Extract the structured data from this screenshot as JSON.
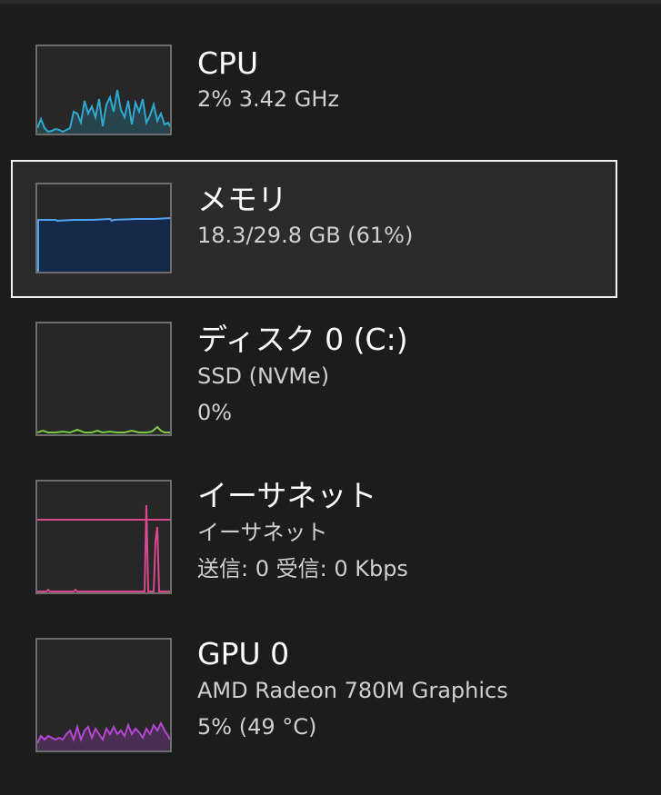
{
  "items": [
    {
      "title": "CPU",
      "line1": "2%  3.42 GHz",
      "line2": "",
      "color": "#2ea8cf",
      "icon": "cpu-usage-graph-icon"
    },
    {
      "title": "メモリ",
      "line1": "18.3/29.8 GB (61%)",
      "line2": "",
      "color": "#4fa3f7",
      "icon": "memory-usage-graph-icon"
    },
    {
      "title": "ディスク 0 (C:)",
      "line1": "SSD (NVMe)",
      "line2": "0%",
      "color": "#7ac943",
      "icon": "disk-activity-graph-icon"
    },
    {
      "title": "イーサネット",
      "line1": "イーサネット",
      "line2": "送信: 0  受信: 0 Kbps",
      "color": "#d9488f",
      "icon": "ethernet-throughput-graph-icon"
    },
    {
      "title": "GPU 0",
      "line1": "AMD Radeon 780M Graphics",
      "line2": "5% (49 °C)",
      "color": "#b545d4",
      "icon": "gpu-usage-graph-icon"
    }
  ],
  "selected_index": 1
}
